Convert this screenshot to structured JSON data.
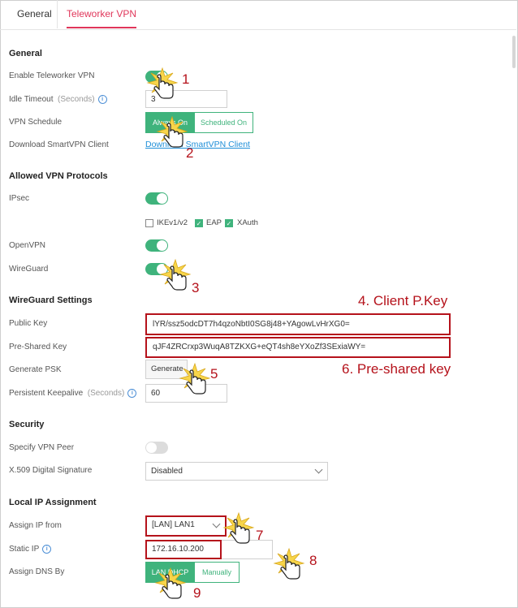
{
  "tabs": [
    {
      "label": "General"
    },
    {
      "label": "Teleworker VPN"
    }
  ],
  "general": {
    "heading": "General",
    "enable_label": "Enable Teleworker VPN",
    "enable_on": true,
    "idle_label": "Idle Timeout",
    "idle_unit": "(Seconds)",
    "idle_value": "3",
    "schedule_label": "VPN Schedule",
    "schedule_options": [
      "Always On",
      "Scheduled On"
    ],
    "schedule_selected": "Always On",
    "download_label": "Download SmartVPN Client",
    "download_link": "Download SmartVPN Client"
  },
  "protocols": {
    "heading": "Allowed VPN Protocols",
    "ipsec_label": "IPsec",
    "ipsec_on": true,
    "ikev1v2_label": "IKEv1/v2",
    "ikev1v2_checked": false,
    "eap_label": "EAP",
    "eap_checked": true,
    "xauth_label": "XAuth",
    "xauth_checked": true,
    "openvpn_label": "OpenVPN",
    "openvpn_on": true,
    "wireguard_label": "WireGuard",
    "wireguard_on": true
  },
  "wireguard": {
    "heading": "WireGuard Settings",
    "public_key_label": "Public Key",
    "public_key_value": "lYR/ssz5odcDT7h4qzoNbtI0SG8j48+YAgowLvHrXG0=",
    "psk_label": "Pre-Shared Key",
    "psk_value": "qJF4ZRCrxp3WuqA8TZKXG+eQT4sh8eYXoZf3SExiaWY=",
    "generate_label": "Generate PSK",
    "generate_button": "Generate",
    "keepalive_label": "Persistent Keepalive",
    "keepalive_unit": "(Seconds)",
    "keepalive_value": "60"
  },
  "security": {
    "heading": "Security",
    "peer_label": "Specify VPN Peer",
    "peer_on": false,
    "x509_label": "X.509 Digital Signature",
    "x509_value": "Disabled"
  },
  "local_ip": {
    "heading": "Local IP Assignment",
    "assign_label": "Assign IP from",
    "assign_value": "[LAN] LAN1",
    "static_label": "Static IP",
    "static_value": "172.16.10.200",
    "dns_label": "Assign DNS By",
    "dns_options": [
      "LAN DHCP",
      "Manually"
    ],
    "dns_selected": "LAN DHCP"
  },
  "annotations": {
    "n1": "1",
    "n2": "2",
    "n3": "3",
    "n5": "5",
    "n7": "7",
    "n8": "8",
    "n9": "9",
    "client_key": "4. Client P.Key",
    "preshared": "6. Pre-shared key"
  },
  "colors": {
    "accent": "#e0365a",
    "toggle_on": "#3fb37c",
    "annotation": "#b5121b",
    "link": "#1f8fd8"
  }
}
